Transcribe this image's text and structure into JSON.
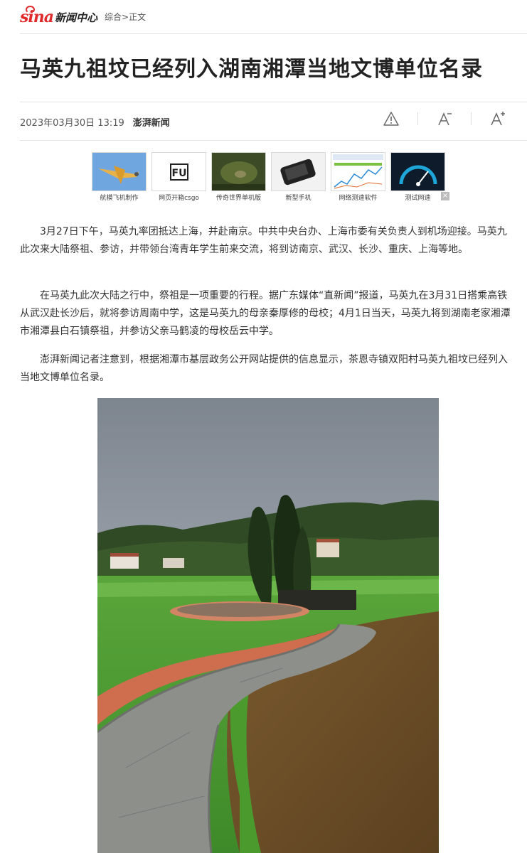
{
  "header": {
    "logo_text": "sina",
    "logo_suffix": "新闻中心",
    "breadcrumb": [
      {
        "label": "综合"
      },
      {
        "label": ">"
      },
      {
        "label": "正文"
      }
    ]
  },
  "article": {
    "title": "马英九祖坟已经列入湖南湘潭当地文博单位名录",
    "datetime": "2023年03月30日 13:19",
    "source": "澎湃新闻",
    "paragraphs": [
      "3月27日下午，马英九率团抵达上海，并赴南京。中共中央台办、上海市委有关负责人到机场迎接。马英九此次来大陆祭祖、参访，并带领台湾青年学生前来交流，将到访南京、武汉、长沙、重庆、上海等地。",
      "在马英九此次大陆之行中，祭祖是一项重要的行程。据广东媒体“直新闻”报道，马英九在3月31日搭乘高铁从武汉赴长沙后，就将参访周南中学，这是马英九的母亲秦厚修的母校；4月1日当天，马英九将到湖南老家湘潭市湘潭县白石镇祭祖，并参访父亲马鹤凌的母校岳云中学。",
      "澎湃新闻记者注意到，根据湘潭市基层政务公开网站提供的信息显示，茶恩寺镇双阳村马英九祖坟已经列入当地文博单位名录。"
    ]
  },
  "tools": {
    "report_icon": "warning-triangle-icon",
    "font_decrease_icon": "font-decrease-icon",
    "font_increase_icon": "font-increase-icon"
  },
  "ads": {
    "items": [
      {
        "caption": "航模飞机制作",
        "icon": "model-airplane-image"
      },
      {
        "caption": "网页开箱csgo",
        "icon": "fu-logo-image"
      },
      {
        "caption": "传奇世界单机版",
        "icon": "game-landscape-image"
      },
      {
        "caption": "新型手机",
        "icon": "black-phone-image"
      },
      {
        "caption": "网络测速软件",
        "icon": "speed-chart-image"
      },
      {
        "caption": "测试网速",
        "icon": "speedometer-image"
      }
    ],
    "close_label": "×"
  },
  "colors": {
    "brand_red": "#e02a2a",
    "text": "#333333",
    "divider": "#e3e3e3"
  }
}
